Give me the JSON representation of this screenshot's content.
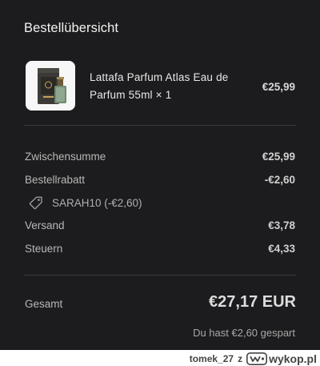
{
  "summary": {
    "title": "Bestellübersicht"
  },
  "item": {
    "name_line1": "Lattafa Parfum Atlas Eau de",
    "name_line2": "Parfum 55ml × 1",
    "price": "€25,99",
    "image_icon": "perfume-bottle-icon"
  },
  "breakdown": {
    "subtotal_label": "Zwischensumme",
    "subtotal_value": "€25,99",
    "discount_label": "Bestellrabatt",
    "discount_value": "-€2,60",
    "discount_code_icon": "tag-icon",
    "discount_code": "SARAH10 (-€2,60)",
    "shipping_label": "Versand",
    "shipping_value": "€3,78",
    "taxes_label": "Steuern",
    "taxes_value": "€4,33"
  },
  "total": {
    "label": "Gesamt",
    "value": "€27,17 EUR",
    "savings": "Du hast €2,60 gespart"
  },
  "watermark": {
    "user": "tomek_27",
    "separator": "z",
    "site": "wykop.pl",
    "logo_icon": "wykop-logo-icon"
  },
  "colors": {
    "panel_background": "#1c1c1e",
    "divider": "#3a3a3c",
    "page_background": "#ffffff"
  }
}
